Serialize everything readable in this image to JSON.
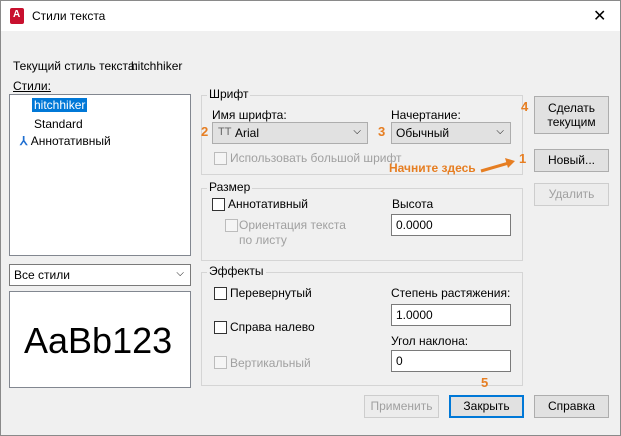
{
  "window": {
    "title": "Стили текста",
    "close_glyph": "✕"
  },
  "current_style": {
    "label": "Текущий стиль текста:",
    "value": "hitchhiker"
  },
  "styles": {
    "label": "Стили:",
    "items": [
      {
        "label": "hitchhiker",
        "selected": true
      },
      {
        "label": "Standard",
        "selected": false
      },
      {
        "label": "Аннотативный",
        "selected": false,
        "icon": "annotative-icon"
      }
    ],
    "filter": "Все стили",
    "preview_text": "AaBb123"
  },
  "font": {
    "group_label": "Шрифт",
    "name_label": "Имя шрифта:",
    "name_value": "Arial",
    "style_label": "Начертание:",
    "style_value": "Обычный",
    "big_font_label": "Использовать большой шрифт"
  },
  "size": {
    "group_label": "Размер",
    "annotative_label": "Аннотативный",
    "orientation_label_1": "Ориентация текста",
    "orientation_label_2": "по листу",
    "height_label": "Высота",
    "height_value": "0.0000"
  },
  "effects": {
    "group_label": "Эффекты",
    "upside_down_label": "Перевернутый",
    "backwards_label": "Справа налево",
    "vertical_label": "Вертикальный",
    "width_factor_label": "Степень растяжения:",
    "width_factor_value": "1.0000",
    "oblique_label": "Угол наклона:",
    "oblique_value": "0"
  },
  "buttons": {
    "set_current": "Сделать текущим",
    "set_current_1": "Сделать",
    "set_current_2": "текущим",
    "new": "Новый...",
    "delete": "Удалить",
    "apply": "Применить",
    "close": "Закрыть",
    "help": "Справка"
  },
  "annotations": {
    "n1": "1",
    "n2": "2",
    "n3": "3",
    "n4": "4",
    "n5": "5",
    "hint": "Начните здесь",
    "color": "#e67e22"
  }
}
